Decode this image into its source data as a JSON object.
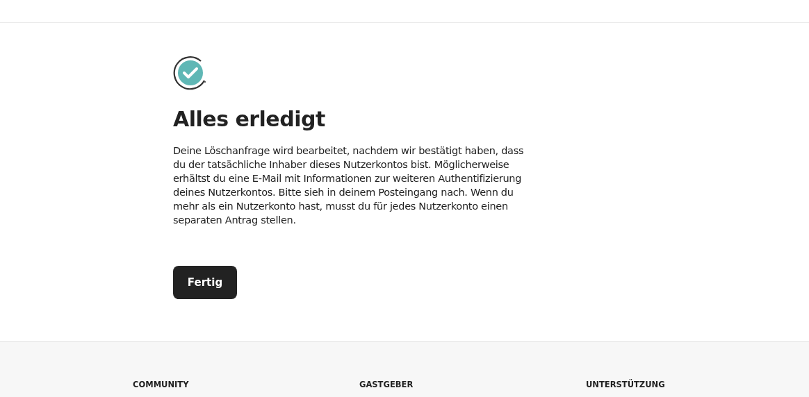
{
  "title": "Alles erledigt",
  "message": "Deine Löschanfrage wird bearbeitet, nachdem wir bestätigt haben, dass du der tatsächliche Inhaber dieses Nutzerkontos bist. Möglicherweise erhältst du eine E-Mail mit Informationen zur weiteren Authentifizierung deines Nutzerkontos. Bitte sieh in deinem Posteingang nach. Wenn du mehr als ein Nutzerkonto hast, musst du für jedes Nutzerkonto einen separaten Antrag stellen.",
  "button": "Fertig",
  "footer": {
    "headings": [
      "COMMUNITY",
      "GASTGEBER",
      "UNTERSTÜTZUNG"
    ]
  }
}
